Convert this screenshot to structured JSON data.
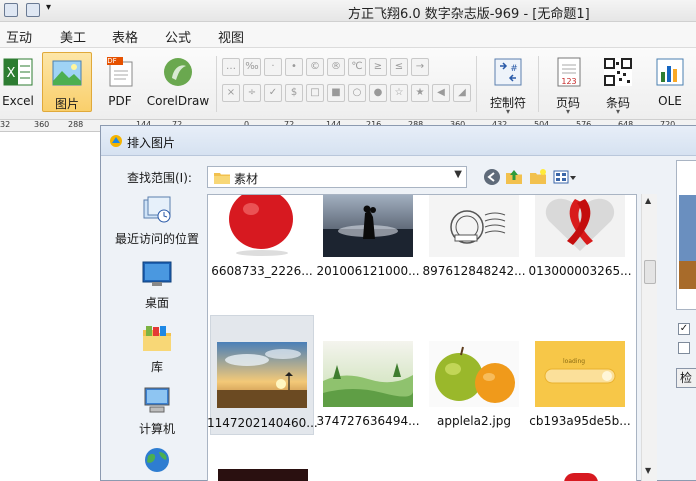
{
  "titlebar": {
    "title": "方正飞翔6.0 数字杂志版-969 - [无命题1]"
  },
  "menu": {
    "items": [
      "互动",
      "美工",
      "表格",
      "公式",
      "视图"
    ]
  },
  "ribbon": {
    "buttons": [
      {
        "label": "Excel",
        "icon": "excel-icon"
      },
      {
        "label": "图片",
        "icon": "picture-icon",
        "active": true
      },
      {
        "label": "PDF",
        "icon": "pdf-icon"
      },
      {
        "label": "CorelDraw",
        "icon": "coreldraw-icon"
      },
      {
        "label": "控制符",
        "icon": "control-char-icon"
      },
      {
        "label": "页码",
        "icon": "page-number-icon"
      },
      {
        "label": "条码",
        "icon": "barcode-icon"
      },
      {
        "label": "OLE",
        "icon": "ole-icon"
      }
    ],
    "pdf_badge": "PDF",
    "symbols_row1": [
      "…",
      "‰",
      "·",
      "•",
      "©",
      "®",
      "℃",
      "≥",
      "≤",
      "→"
    ],
    "symbols_row2": [
      "×",
      "÷",
      "✓",
      "$",
      "□",
      "■",
      "○",
      "●",
      "☆",
      "★",
      "◀",
      "◢"
    ]
  },
  "ruler": {
    "labels": [
      "32",
      "360",
      "288",
      "144",
      "72",
      "0",
      "72",
      "144",
      "216",
      "288",
      "360",
      "432",
      "504",
      "576",
      "648",
      "720"
    ]
  },
  "dialog": {
    "title": "排入图片",
    "look_in_label": "查找范围(I):",
    "look_in_value": "素材",
    "places": [
      "最近访问的位置",
      "桌面",
      "库",
      "计算机",
      "网络"
    ],
    "files": [
      {
        "name": "6608733_2226...",
        "kind": "apple"
      },
      {
        "name": "201006121000...",
        "kind": "couple"
      },
      {
        "name": "897612848242...",
        "kind": "stamp"
      },
      {
        "name": "013000003265...",
        "kind": "ribbon"
      },
      {
        "name": "1147202140460...",
        "kind": "sunset",
        "selected": true
      },
      {
        "name": "374727636494...",
        "kind": "meadow"
      },
      {
        "name": "applela2.jpg",
        "kind": "fruits"
      },
      {
        "name": "cb193a95de5b...",
        "kind": "loading"
      }
    ],
    "loading_text": "loading",
    "side_checks": [
      "✓",
      ""
    ],
    "side_button": "检"
  },
  "colors": {
    "active_button": "#f9cf6b",
    "dialog_bg": "#eef2f7",
    "selected_item": "#e3e7ec"
  }
}
